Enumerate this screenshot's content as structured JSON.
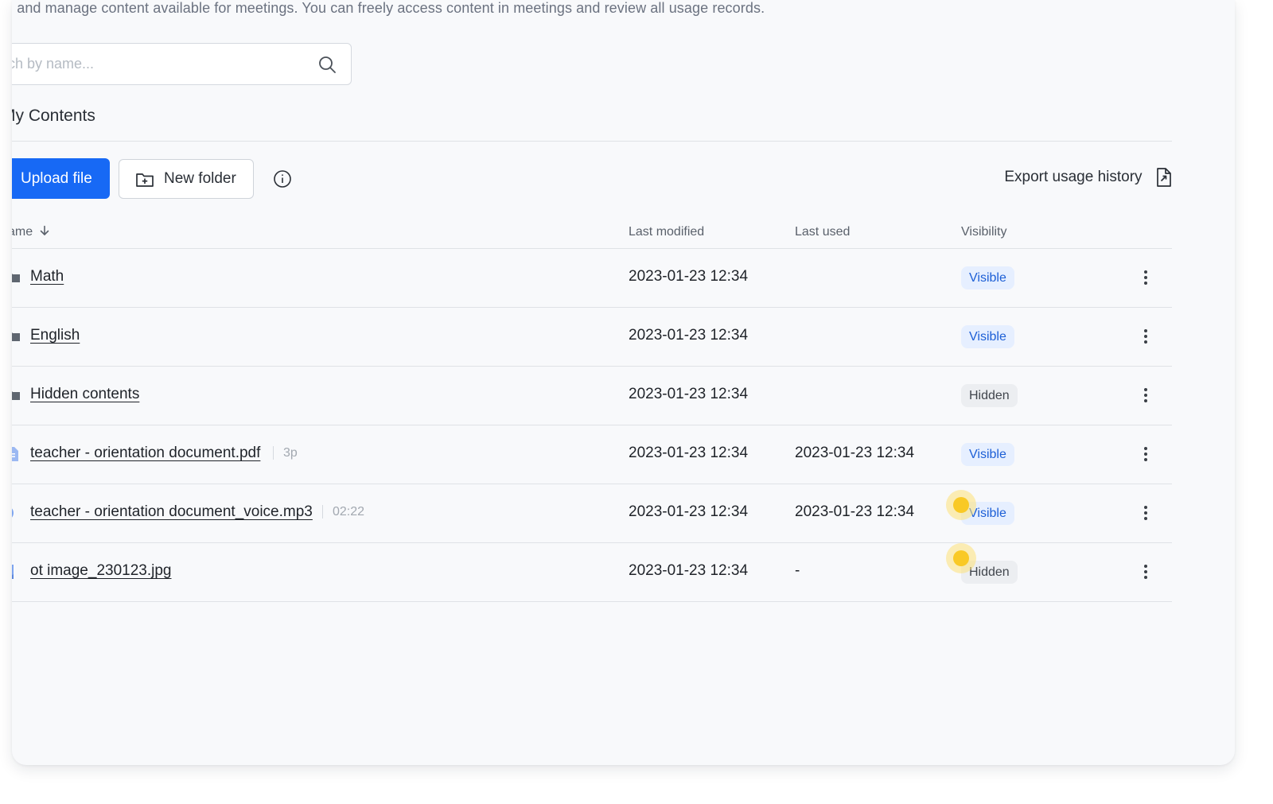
{
  "description": "d and manage content available for meetings. You can freely access content in meetings and review all usage records.",
  "search": {
    "placeholder": "rch by name..."
  },
  "section_title": "My Contents",
  "toolbar": {
    "upload_label": "Upload file",
    "new_folder_label": "New folder",
    "export_label": "Export usage history"
  },
  "table": {
    "headers": {
      "name": "ame",
      "last_modified": "Last modified",
      "last_used": "Last used",
      "visibility": "Visibility"
    },
    "rows": [
      {
        "type": "folder",
        "name": "Math",
        "meta": "",
        "last_modified": "2023-01-23 12:34",
        "last_used": "",
        "visibility": "Visible"
      },
      {
        "type": "folder",
        "name": "English",
        "meta": "",
        "last_modified": "2023-01-23 12:34",
        "last_used": "",
        "visibility": "Visible"
      },
      {
        "type": "folder",
        "name": "Hidden contents",
        "meta": "",
        "last_modified": "2023-01-23 12:34",
        "last_used": "",
        "visibility": "Hidden"
      },
      {
        "type": "pdf",
        "name": "teacher - orientation document.pdf",
        "meta": "3p",
        "last_modified": "2023-01-23 12:34",
        "last_used": "2023-01-23 12:34",
        "visibility": "Visible"
      },
      {
        "type": "audio",
        "name": "teacher - orientation document_voice.mp3",
        "meta": "02:22",
        "last_modified": "2023-01-23 12:34",
        "last_used": "2023-01-23 12:34",
        "visibility": "Visible"
      },
      {
        "type": "image",
        "name": "ot image_230123.jpg",
        "meta": "",
        "last_modified": "2023-01-23 12:34",
        "last_used": "-",
        "visibility": "Hidden"
      }
    ]
  },
  "colors": {
    "primary": "#1769f5",
    "visible_badge_bg": "#e6efff",
    "visible_badge_text": "#1d5fd6",
    "hidden_badge_bg": "#eceef1",
    "cursor_highlight": "#f9c925"
  },
  "icons": {
    "search": "search-icon",
    "new_folder": "folder-plus-icon",
    "info": "info-icon",
    "export": "file-export-icon",
    "sort": "arrow-down-icon",
    "more": "kebab-menu-icon"
  }
}
